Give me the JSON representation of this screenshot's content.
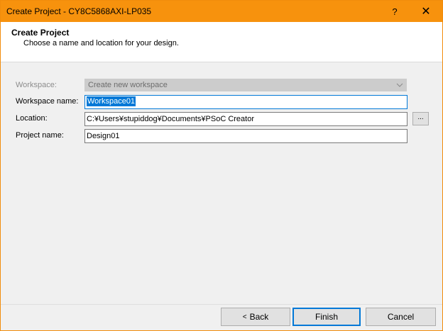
{
  "window": {
    "title": "Create Project - CY8C5868AXI-LP035",
    "help_label": "?",
    "close_label": "✕"
  },
  "header": {
    "title": "Create Project",
    "subtitle": "Choose a name and location for your design."
  },
  "form": {
    "workspace": {
      "label": "Workspace:",
      "selected": "Create new workspace",
      "disabled": true
    },
    "workspace_name": {
      "label": "Workspace name:",
      "value": "Workspace01"
    },
    "location": {
      "label": "Location:",
      "value": "C:¥Users¥stupiddog¥Documents¥PSoC Creator",
      "browse_label": "..."
    },
    "project_name": {
      "label": "Project name:",
      "value": "Design01"
    }
  },
  "buttons": {
    "back_chevron": "<",
    "back": "Back",
    "finish": "Finish",
    "cancel": "Cancel"
  },
  "colors": {
    "titlebar": "#f7920d",
    "accent": "#0078d7"
  },
  "icons": {
    "help": "help-icon",
    "close": "close-icon",
    "dropdown": "chevron-down-icon"
  }
}
